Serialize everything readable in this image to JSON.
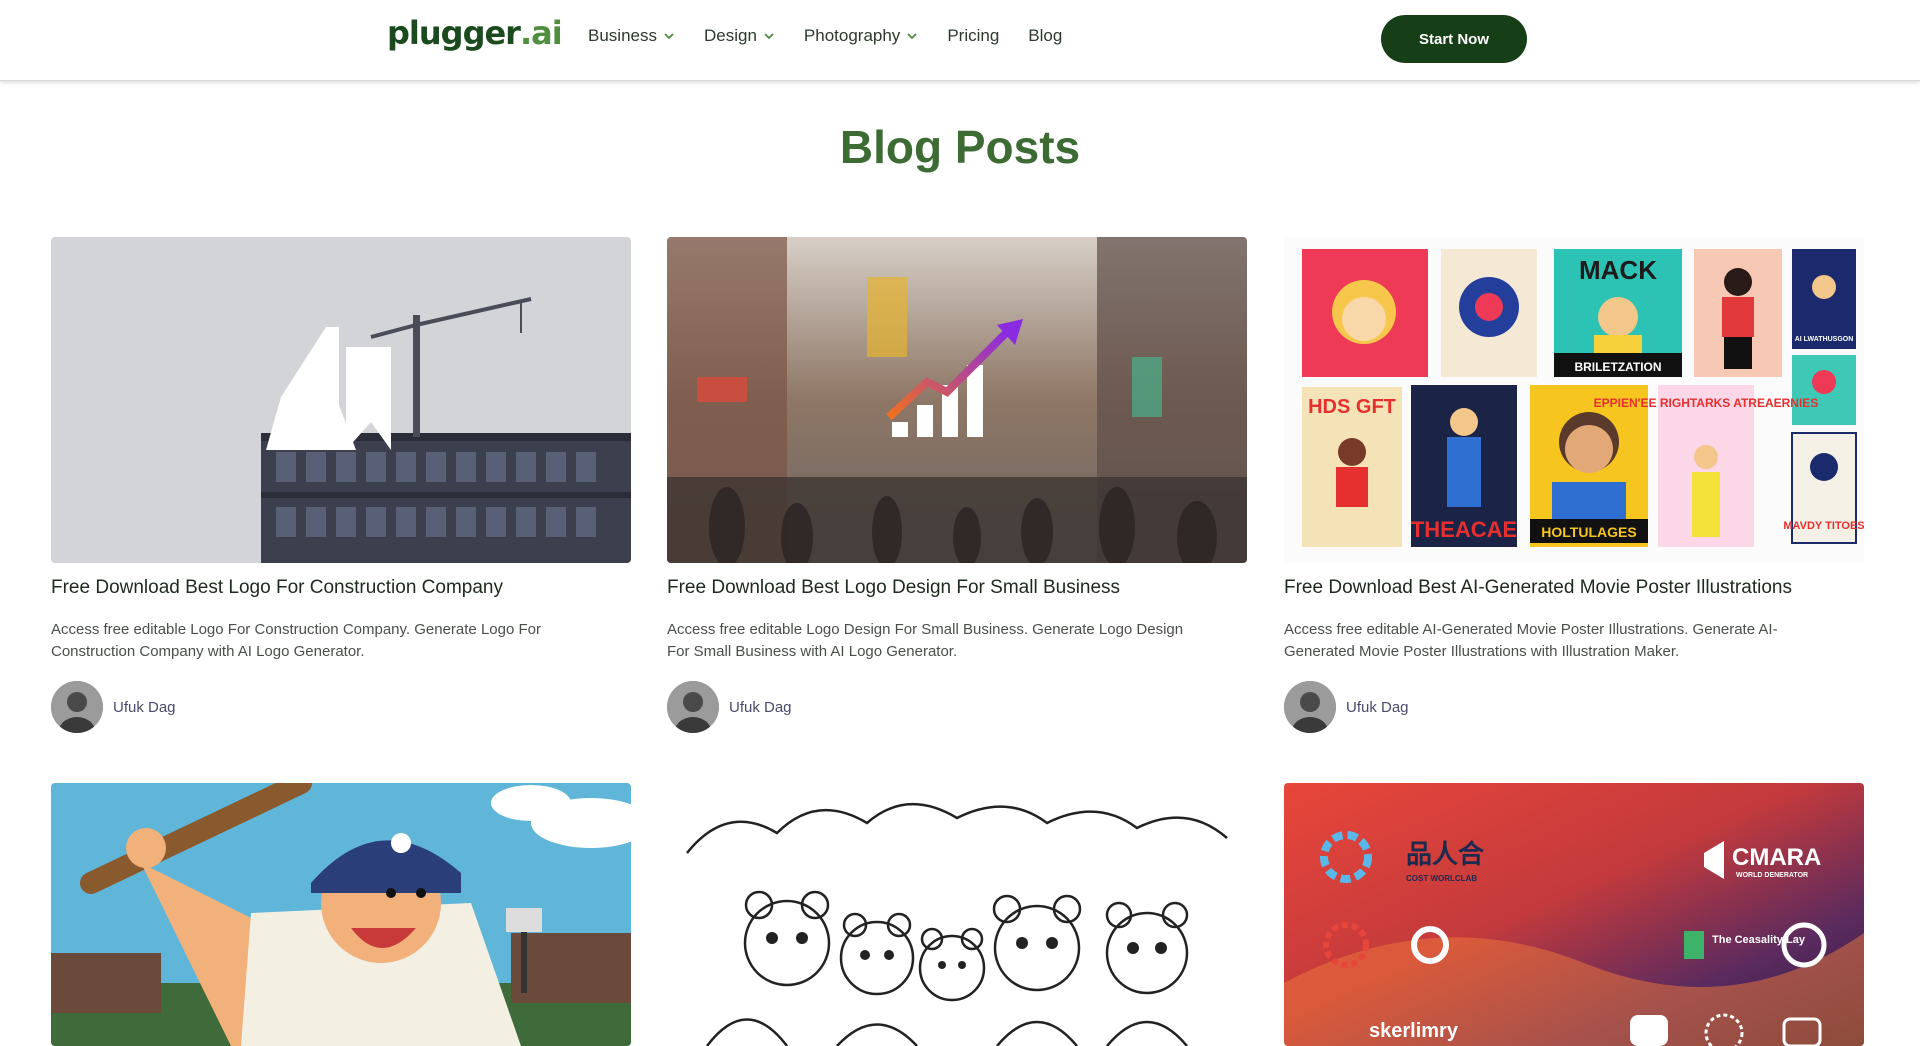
{
  "header": {
    "logo_main": "plugger",
    "logo_ext": ".ai",
    "nav": [
      {
        "label": "Business",
        "has_dropdown": true
      },
      {
        "label": "Design",
        "has_dropdown": true
      },
      {
        "label": "Photography",
        "has_dropdown": true
      },
      {
        "label": "Pricing",
        "has_dropdown": false
      },
      {
        "label": "Blog",
        "has_dropdown": false
      }
    ],
    "cta_label": "Start Now"
  },
  "page_title": "Blog Posts",
  "posts": [
    {
      "title": "Free Download Best Logo For Construction Company",
      "description": "Access free editable Logo For Construction Company. Generate Logo For Construction Company with AI Logo Generator.",
      "author": "Ufuk Dag",
      "image": "construction-logo-building-crane"
    },
    {
      "title": "Free Download Best Logo Design For Small Business",
      "description": "Access free editable Logo Design For Small Business. Generate Logo Design For Small Business with AI Logo Generator.",
      "author": "Ufuk Dag",
      "image": "growth-chart-logo-city-street"
    },
    {
      "title": "Free Download Best AI-Generated Movie Poster Illustrations",
      "description": "Access free editable AI-Generated Movie Poster Illustrations. Generate AI-Generated Movie Poster Illustrations with Illustration Maker.",
      "author": "Ufuk Dag",
      "image": "cartoon-movie-posters-grid",
      "poster_texts": [
        "MACK",
        "BRILETZATION",
        "HDS GFT",
        "THEACAE",
        "HOLTULAGES",
        "EPPIEN'EE RIGHTARKS ATREAERNIES",
        "AI LWATHUSGON",
        "MAVDY TITOES"
      ]
    },
    {
      "image": "cartoon-baseball-player"
    },
    {
      "image": "coloring-page-bears"
    },
    {
      "image": "logo-collection-gradient",
      "logo_texts": [
        "CMARA",
        "WORLD DENERATOR",
        "The Ceasality Lay",
        "skerlimry",
        "COST WORLCLAB"
      ]
    }
  ],
  "colors": {
    "brand_dark": "#173f17",
    "title_green": "#3c6b34"
  }
}
